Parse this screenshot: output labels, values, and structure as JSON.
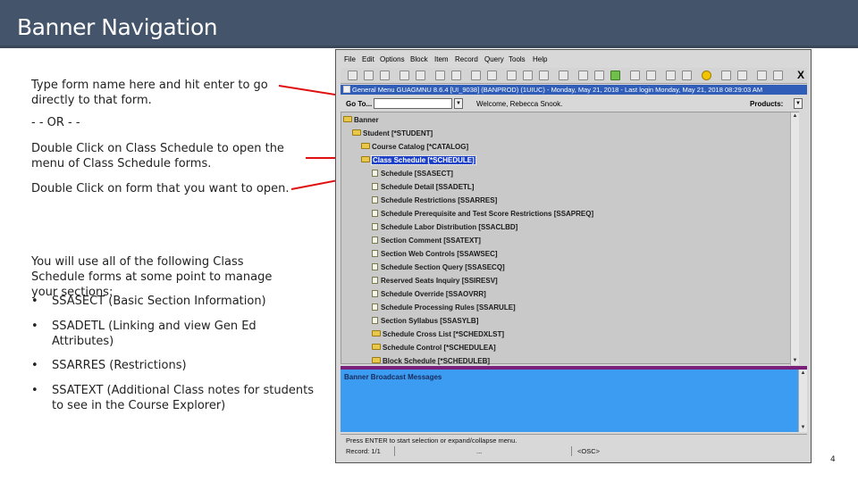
{
  "header": {
    "title": "Banner Navigation"
  },
  "instructions": {
    "step1": "Type form name here and hit enter to go directly to that form.",
    "or": "- - OR - -",
    "step2": "Double Click on Class Schedule to open the menu of Class Schedule forms.",
    "step3": "Double Click on form that you want to open.",
    "intro": "You will use all of the following Class Schedule forms at some point to manage your sections:",
    "bullets": [
      "SSASECT (Basic Section Information)",
      "SSADETL (Linking and view Gen Ed Attributes)",
      "SSARRES (Restrictions)",
      "SSATEXT (Additional Class notes for students to see in the Course Explorer)"
    ]
  },
  "banner": {
    "menu": [
      "File",
      "Edit",
      "Options",
      "Block",
      "Item",
      "Record",
      "Query",
      "Tools",
      "Help"
    ],
    "titlebar": "General Menu  GUAGMNU  8.6.4  [UI_9038]  (BANPROD)  (1UIUC) - Monday, May 21, 2018 - Last login Monday, May 21, 2018 08:29:03 AM",
    "goto_label": "Go To...",
    "goto_value": "",
    "welcome": "Welcome, Rebecca Snook.",
    "products_label": "Products:",
    "tree": [
      {
        "label": "Banner",
        "icon": "folder-icon"
      },
      {
        "label": "Student [*STUDENT]",
        "icon": "folder-icon"
      },
      {
        "label": "Course Catalog [*CATALOG]",
        "icon": "folder-icon"
      },
      {
        "label": "Class Schedule [*SCHEDULE]",
        "icon": "folder-icon",
        "selected": true
      },
      {
        "label": "Schedule [SSASECT]",
        "icon": "form-icon"
      },
      {
        "label": "Schedule Detail [SSADETL]",
        "icon": "form-icon"
      },
      {
        "label": "Schedule Restrictions [SSARRES]",
        "icon": "form-icon"
      },
      {
        "label": "Schedule Prerequisite and Test Score Restrictions [SSAPREQ]",
        "icon": "form-icon"
      },
      {
        "label": "Schedule Labor Distribution [SSACLBD]",
        "icon": "form-icon"
      },
      {
        "label": "Section Comment [SSATEXT]",
        "icon": "form-icon"
      },
      {
        "label": "Section Web Controls [SSAWSEC]",
        "icon": "form-icon"
      },
      {
        "label": "Schedule Section Query [SSASECQ]",
        "icon": "form-icon"
      },
      {
        "label": "Reserved Seats Inquiry [SSIRESV]",
        "icon": "form-icon"
      },
      {
        "label": "Schedule Override [SSAOVRR]",
        "icon": "form-icon"
      },
      {
        "label": "Schedule Processing Rules [SSARULE]",
        "icon": "form-icon"
      },
      {
        "label": "Section Syllabus [SSASYLB]",
        "icon": "form-icon"
      },
      {
        "label": "Schedule Cross List [*SCHEDXLST]",
        "icon": "folder-icon"
      },
      {
        "label": "Schedule Control [*SCHEDULEA]",
        "icon": "folder-icon"
      },
      {
        "label": "Block Schedule [*SCHEDULEB]",
        "icon": "folder-icon"
      }
    ],
    "messages_label": "Banner Broadcast Messages",
    "status_message": "Press ENTER to start selection or expand/collapse menu.",
    "record": "Record: 1/1",
    "ellipsis": "...",
    "osc": "<OSC>"
  },
  "page_number": "4",
  "colors": {
    "header_bg": "#44546a",
    "arrow": "#e01010",
    "titlebar": "#2f5db8",
    "selection": "#1c3fc8",
    "messages_bg": "#3b9cf2",
    "divider": "#7a1f7a"
  }
}
